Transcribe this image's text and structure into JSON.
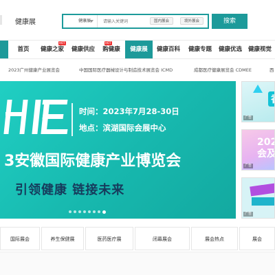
{
  "header": {
    "site_name": "健康展",
    "search": {
      "category": "健康展",
      "placeholder": "请输入关键词",
      "scope_domestic": "国内展会",
      "scope_overseas": "境外展会",
      "button": "搜索"
    }
  },
  "nav": {
    "items": [
      {
        "label": "首页"
      },
      {
        "label": "健康之家",
        "badge": "HOT"
      },
      {
        "label": "健康供应"
      },
      {
        "label": "购健康",
        "badge": "HOT"
      },
      {
        "label": "健康展",
        "active": true
      },
      {
        "label": "健康百科"
      },
      {
        "label": "健康专题"
      },
      {
        "label": "健康优选"
      },
      {
        "label": "健康视觉"
      }
    ]
  },
  "tickers": [
    "2023广州健康产业展览会",
    "中国国际医疗器械设计与制造技术展览会 ICMD",
    "成都医疗健康展览会 CDMEE",
    "西"
  ],
  "banner": {
    "logo_text": "HIE",
    "time_line": "时间：2023年7月28-30日",
    "venue_line": "地点：滨湖国际会展中心",
    "title": "3安徽国际健康产业博览会",
    "slogan": "引领健康  链接未来",
    "slide_count": 8,
    "active_slide": 8
  },
  "ads": [
    {
      "label": "广告",
      "text": "香"
    },
    {
      "label": "广告",
      "text": "2022\n会及"
    },
    {
      "label": "广告",
      "text": "\n"
    }
  ],
  "categories": [
    "国际展会",
    "养生保健展",
    "医药医疗展",
    "闭幕展会",
    "展会热点",
    "展会"
  ],
  "colors": {
    "brand": "#1d9a9a",
    "banner": "#1bbfb4",
    "slogan": "#163b5c"
  }
}
